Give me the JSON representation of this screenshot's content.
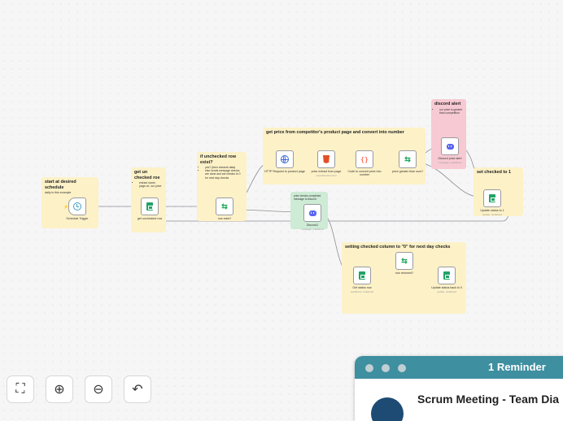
{
  "stickies": {
    "start": {
      "title": "start at desired schedule",
      "body": "daily in this example"
    },
    "unchecked": {
      "title": "get un checked roe",
      "bullets": [
        "extract name, page url, our price"
      ]
    },
    "ifrow": {
      "title": "if unchecked row exist?",
      "bullets": [
        "yes? (then extracts data)",
        "else sends message checks are done and set checks to 0 for next day checks"
      ]
    },
    "price": {
      "title": "get price from competitor's product page and convert into number"
    },
    "alert": {
      "title": "discord alert",
      "bullets": [
        "our price is greater than competition"
      ]
    },
    "setone": {
      "title": "set checked to 1"
    },
    "checksdone": {
      "title": "price checks completed message to discord"
    },
    "resetting": {
      "title": "setting checked column to \"0\" for next day checks"
    }
  },
  "nodes": {
    "schedule": {
      "label": "Schedule Trigger",
      "icon": "clock-icon"
    },
    "get_unchecked": {
      "label": "get unchecked row",
      "icon": "google-sheets-icon"
    },
    "row_exist": {
      "label": "row exist?",
      "icon": "if-branch-icon"
    },
    "http": {
      "label": "HTTP Request to product page",
      "icon": "globe-icon"
    },
    "extract": {
      "label": "price extract from page",
      "sub": "extractHtmlContent",
      "icon": "html-icon"
    },
    "code": {
      "label": "Code to convert price into number",
      "icon": "code-icon"
    },
    "greater": {
      "label": "price greater than ours?",
      "icon": "if-branch-icon"
    },
    "discord_alert": {
      "label": "Discord price alert",
      "sub": "message: undefined",
      "icon": "discord-icon"
    },
    "update1": {
      "label": "Update status to 1",
      "sub": "update: undefined",
      "icon": "google-sheets-icon"
    },
    "discord2": {
      "label": "Discord1",
      "sub": "message: undefined",
      "icon": "discord-icon"
    },
    "get_status": {
      "label": "Get status row",
      "sub": "readRows: undefined",
      "icon": "google-sheets-icon"
    },
    "row_returned": {
      "label": "row returned?",
      "icon": "if-branch-icon"
    },
    "update_back": {
      "label": "Update status back to 0",
      "sub": "update: undefined",
      "icon": "google-sheets-icon"
    }
  },
  "toolbar": {
    "fit": {
      "icon": "fit-view-icon",
      "glyph": "⛶"
    },
    "zoom_in": {
      "icon": "zoom-in-icon",
      "glyph": "⊕"
    },
    "zoom_out": {
      "icon": "zoom-out-icon",
      "glyph": "⊖"
    },
    "undo": {
      "icon": "undo-icon",
      "glyph": "↶"
    }
  },
  "reminder": {
    "count": "1 Reminder",
    "title": "Scrum Meeting - Team Dia"
  },
  "colors": {
    "sticky_yellow": "#fdf1c7",
    "sticky_pink": "#f7c9d2",
    "sticky_green": "#cdebd5",
    "edge": "#8e8e93",
    "reminder_bar": "#3e8fa0"
  }
}
